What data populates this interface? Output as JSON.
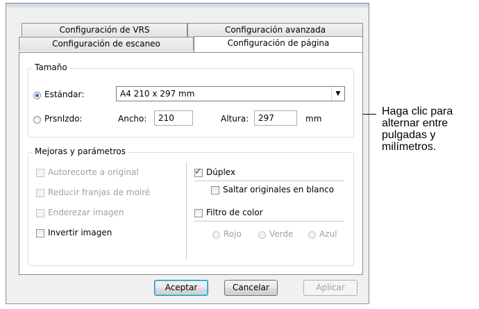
{
  "tabs": {
    "back": [
      "Configuración de VRS",
      "Configuración avanzada"
    ],
    "front": [
      "Configuración de escaneo",
      "Configuración de página"
    ],
    "active": "Configuración de página"
  },
  "size_group": {
    "title": "Tamaño",
    "standard_label": "Estándar:",
    "standard_selected": true,
    "standard_value": "A4 210 x 297 mm",
    "custom_label": "Prsnlzdo:",
    "width_label": "Ancho:",
    "width_value": "210",
    "height_label": "Altura:",
    "height_value": "297",
    "unit_label": "mm"
  },
  "enhance_group": {
    "title": "Mejoras y parámetros",
    "options": [
      {
        "label": "Autorecorte a original",
        "checked": false,
        "enabled": false
      },
      {
        "label": "Reducir franjas de moiré",
        "checked": false,
        "enabled": false
      },
      {
        "label": "Enderezar imagen",
        "checked": false,
        "enabled": false
      },
      {
        "label": "Invertir imagen",
        "checked": false,
        "enabled": true
      }
    ],
    "duplex_label": "Dúplex",
    "duplex_checked": true,
    "skip_blank_label": "Saltar originales en blanco",
    "color_filter_label": "Filtro de color",
    "color_filter_checked": false,
    "colors": [
      "Rojo",
      "Verde",
      "Azul"
    ]
  },
  "buttons": {
    "ok": "Aceptar",
    "cancel": "Cancelar",
    "apply": "Aplicar"
  },
  "callout": {
    "lines": [
      "Haga clic para",
      "alternar entre",
      "pulgadas y",
      "milímetros."
    ]
  }
}
